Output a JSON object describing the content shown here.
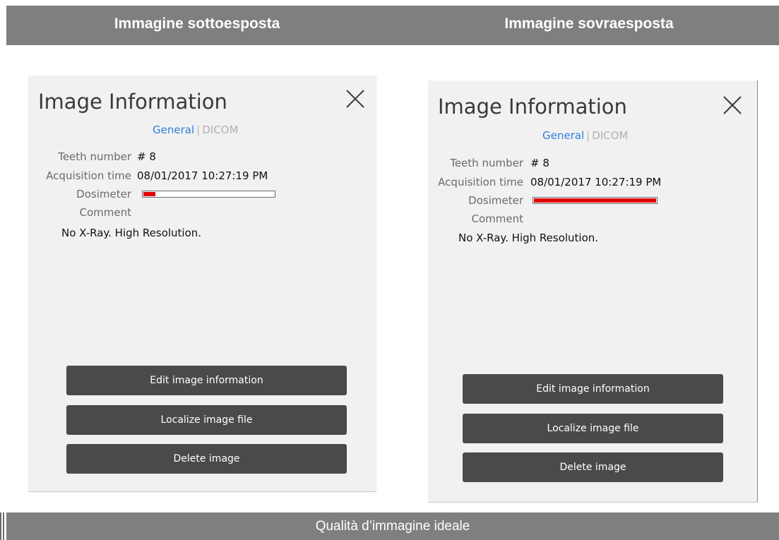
{
  "header": {
    "left_title": "Immagine sottoesposta",
    "right_title": "Immagine sovraesposta"
  },
  "footer": {
    "caption": "Qualità d’immagine ideale"
  },
  "colors": {
    "header_bg": "#7f7f7f",
    "panel_bg": "#f1f1f1",
    "tab_active": "#2f7fd8",
    "tab_inactive": "#b0b0b0",
    "button_bg": "#4a4a4a",
    "dosimeter_fill": "#e00000"
  },
  "panels": [
    {
      "title": "Image Information",
      "close_icon": "close-icon",
      "tabs": {
        "general": "General",
        "separator": "|",
        "dicom": "DICOM"
      },
      "fields": {
        "teeth_label": "Teeth number",
        "teeth_value": "# 8",
        "acq_label": "Acquisition time",
        "acq_value": "08/01/2017 10:27:19 PM",
        "dosimeter_label": "Dosimeter",
        "dosimeter_level_percent": 10,
        "comment_label": "Comment",
        "comment_value": "No X-Ray. High Resolution."
      },
      "buttons": {
        "edit": "Edit image information",
        "localize": "Localize image file",
        "delete": "Delete image"
      }
    },
    {
      "title": "Image Information",
      "close_icon": "close-icon",
      "tabs": {
        "general": "General",
        "separator": "|",
        "dicom": "DICOM"
      },
      "fields": {
        "teeth_label": "Teeth number",
        "teeth_value": "# 8",
        "acq_label": "Acquisition time",
        "acq_value": "08/01/2017 10:27:19 PM",
        "dosimeter_label": "Dosimeter",
        "dosimeter_level_percent": 100,
        "comment_label": "Comment",
        "comment_value": "No X-Ray. High Resolution."
      },
      "buttons": {
        "edit": "Edit image information",
        "localize": "Localize image file",
        "delete": "Delete image"
      }
    }
  ]
}
